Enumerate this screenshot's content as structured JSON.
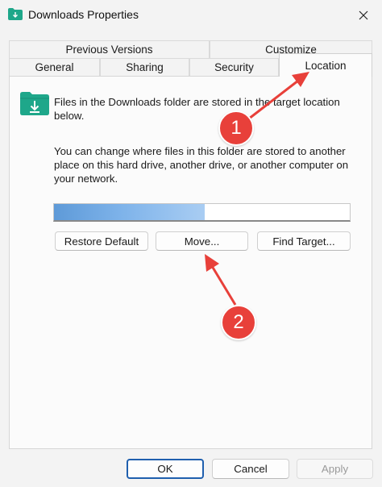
{
  "window": {
    "title": "Downloads Properties",
    "icon": "folder-download-icon",
    "close_icon": "close-icon"
  },
  "tabs": {
    "row1": [
      {
        "label": "Previous Versions"
      },
      {
        "label": "Customize"
      }
    ],
    "row2": [
      {
        "label": "General"
      },
      {
        "label": "Sharing"
      },
      {
        "label": "Security"
      },
      {
        "label": "Location",
        "selected": true
      }
    ]
  },
  "location": {
    "folder_icon": "folder-download-icon",
    "info_text": "Files in the Downloads folder are stored in the target location below.",
    "change_text": "You can change where files in this folder are stored to another place on this hard drive, another drive, or another computer on your network.",
    "path_value": "",
    "buttons": {
      "restore": "Restore Default",
      "move": "Move...",
      "find": "Find Target..."
    }
  },
  "footer": {
    "ok": "OK",
    "cancel": "Cancel",
    "apply": "Apply",
    "apply_enabled": false
  },
  "annotations": {
    "badge1": "1",
    "badge2": "2",
    "color": "#e8403a"
  },
  "colors": {
    "accent": "#1f5fae",
    "folder": "#1ea78a",
    "annotation": "#e8403a"
  }
}
